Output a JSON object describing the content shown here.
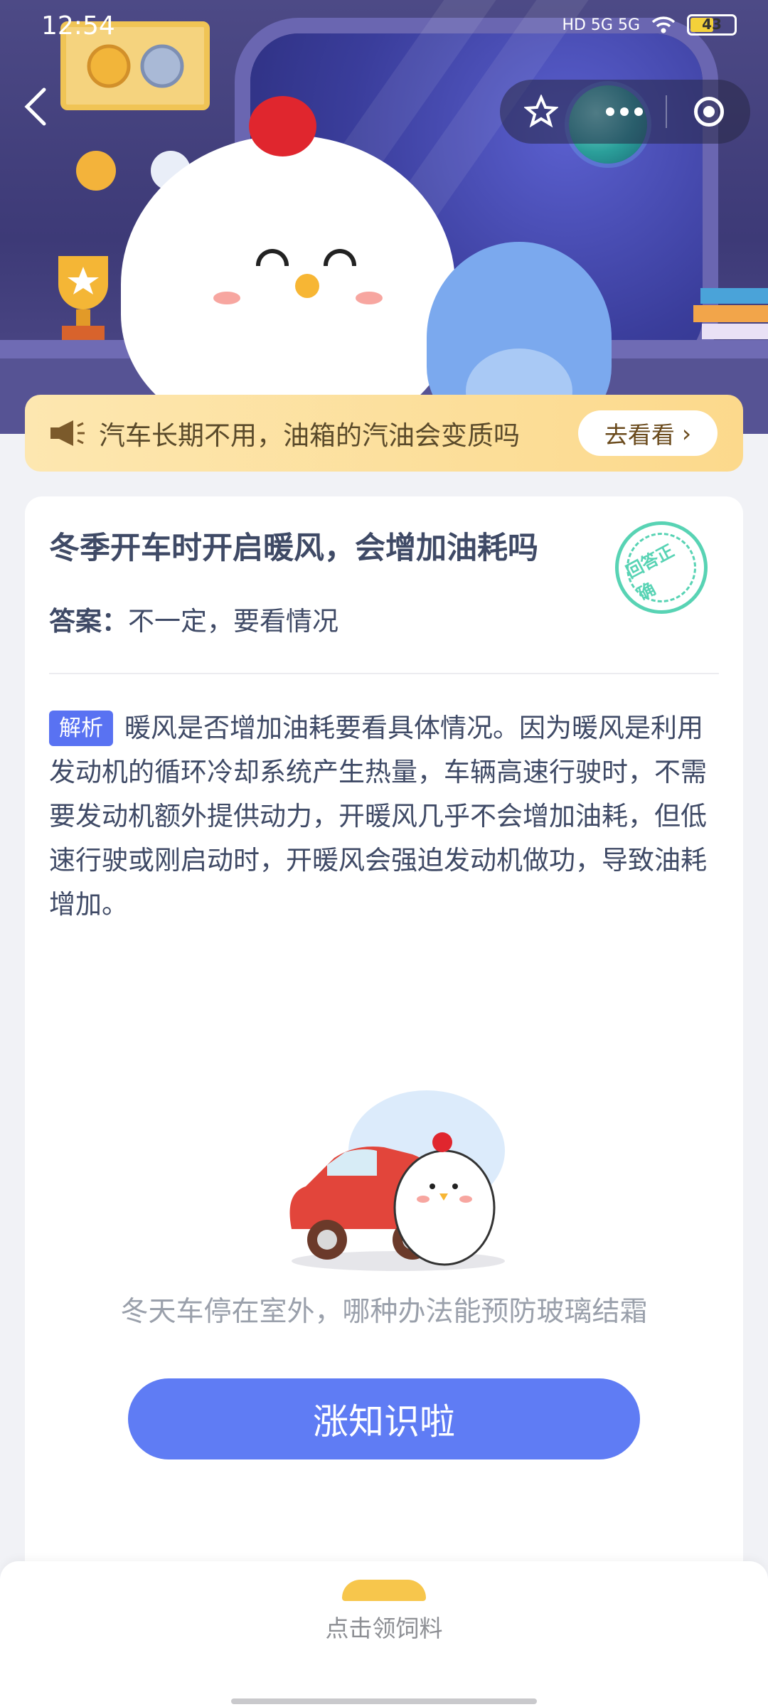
{
  "status_bar": {
    "time": "12:54",
    "network": "HD 5G 5G",
    "battery": "43"
  },
  "header": {
    "favorite_icon": "star-icon",
    "more_icon": "ellipsis-icon",
    "target_icon": "record-icon"
  },
  "notice": {
    "text": "汽车长期不用，油箱的汽油会变质吗",
    "button": "去看看"
  },
  "question": {
    "title": "冬季开车时开启暖风，会增加油耗吗",
    "answer_label": "答案：",
    "answer_value": "不一定，要看情况",
    "stamp": "回答正确"
  },
  "explanation": {
    "tag": "解析",
    "text": "暖风是否增加油耗要看具体情况。因为暖风是利用发动机的循环冷却系统产生热量，车辆高速行驶时，不需要发动机额外提供动力，开暖风几乎不会增加油耗，但低速行驶或刚启动时，开暖风会强迫发动机做功，导致油耗增加。"
  },
  "next": {
    "question": "冬天车停在室外，哪种办法能预防玻璃结霜",
    "button": "涨知识啦"
  },
  "bottom": {
    "label": "点击领饲料"
  },
  "colors": {
    "accent": "#5f7cf4",
    "tag": "#5972f2",
    "stamp": "#58d3b4",
    "notice_bg": "#fcd98c"
  }
}
